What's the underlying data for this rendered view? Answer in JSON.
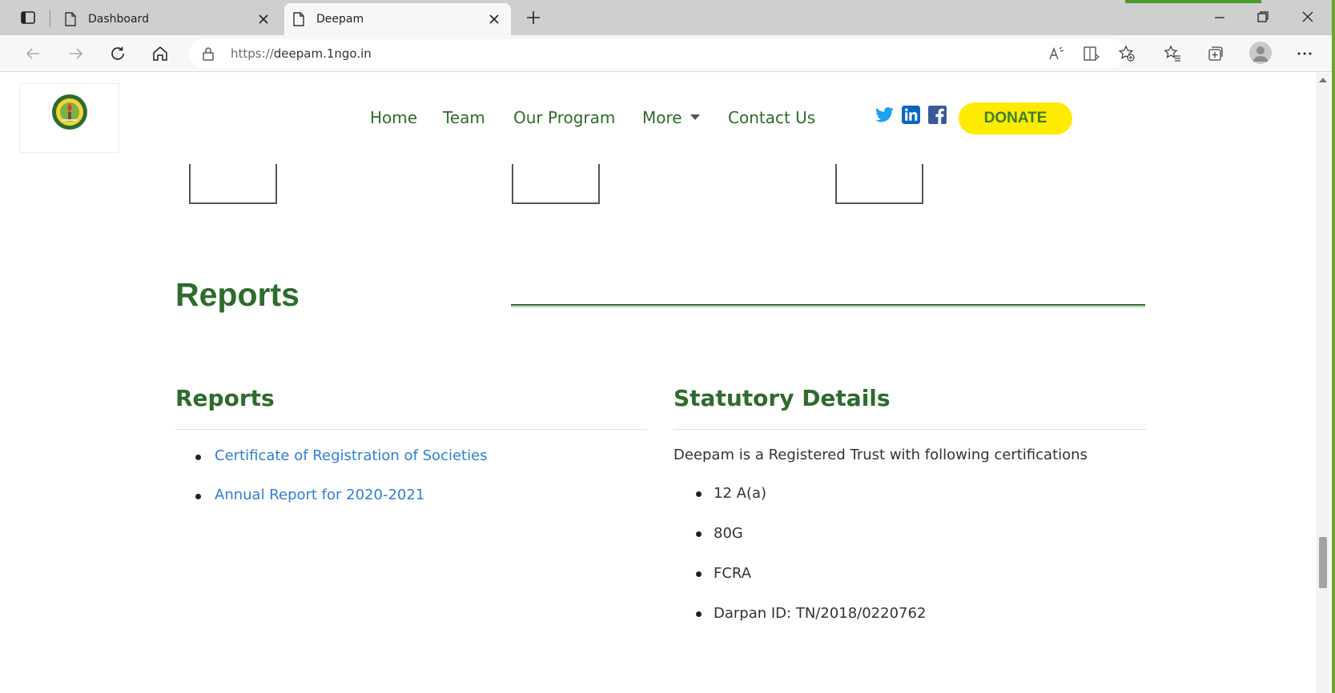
{
  "browser": {
    "tabs": [
      {
        "label": "Dashboard",
        "active": false
      },
      {
        "label": "Deepam",
        "active": true
      }
    ],
    "url_protocol": "https://",
    "url_host": "deepam.1ngo.in"
  },
  "site": {
    "nav": [
      "Home",
      "Team",
      "Our Program",
      "More",
      "Contact Us"
    ],
    "social_icons": [
      "twitter-icon",
      "linkedin-icon",
      "facebook-icon"
    ],
    "donate_label": "DONATE"
  },
  "reports_section": {
    "title": "Reports",
    "reports": {
      "heading": "Reports",
      "links": [
        "Certificate of Registration of Societies",
        "Annual Report for 2020-2021"
      ]
    },
    "statutory": {
      "heading": "Statutory Details",
      "intro": "Deepam is a Registered Trust with following certifications",
      "items": [
        "12 A(a)",
        "80G",
        "FCRA",
        "Darpan ID: TN/2018/0220762"
      ]
    }
  },
  "colors": {
    "brand_green": "#2e6b2e",
    "link_blue": "#2f7fd3",
    "donate_yellow": "#ffeb00"
  }
}
